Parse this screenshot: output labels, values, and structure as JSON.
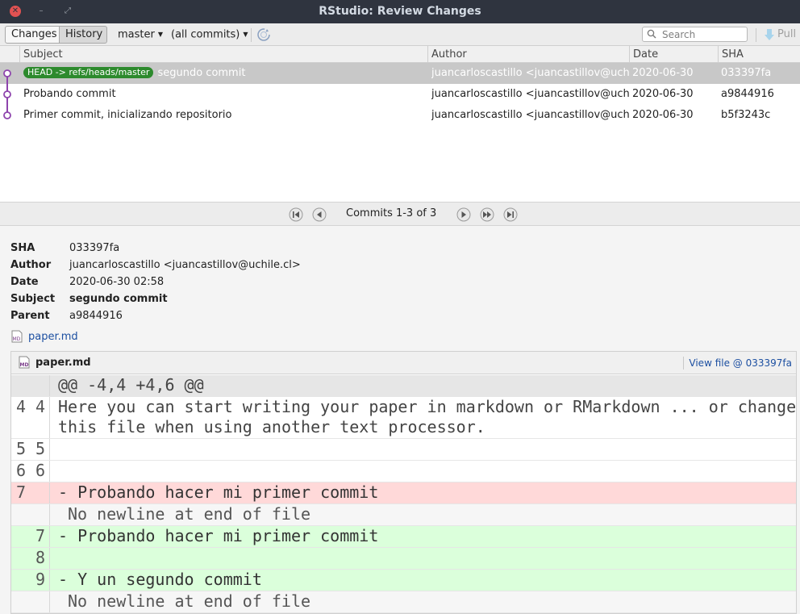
{
  "window": {
    "title": "RStudio: Review Changes"
  },
  "toolbar": {
    "changes_label": "Changes",
    "history_label": "History",
    "branch": "master",
    "filter": "(all commits)",
    "search_placeholder": "Search",
    "pull_label": "Pull"
  },
  "columns": {
    "subject": "Subject",
    "author": "Author",
    "date": "Date",
    "sha": "SHA"
  },
  "commits": [
    {
      "badge": "HEAD -> refs/heads/master",
      "subject": "segundo commit",
      "author": "juancarloscastillo <juancastillov@uchile.cl>",
      "date": "2020-06-30",
      "sha": "033397fa"
    },
    {
      "badge": "",
      "subject": "Probando commit",
      "author": "juancarloscastillo <juancastillov@uchile.cl>",
      "date": "2020-06-30",
      "sha": "a9844916"
    },
    {
      "badge": "",
      "subject": "Primer commit, inicializando repositorio",
      "author": "juancarloscastillo <juancastillov@uchile.cl>",
      "date": "2020-06-30",
      "sha": "b5f3243c"
    }
  ],
  "pager": {
    "label": "Commits 1-3 of 3"
  },
  "detail": {
    "sha_key": "SHA",
    "sha": "033397fa",
    "author_key": "Author",
    "author": "juancarloscastillo <juancastillov@uchile.cl>",
    "date_key": "Date",
    "date": "2020-06-30 02:58",
    "subject_key": "Subject",
    "subject": "segundo commit",
    "parent_key": "Parent",
    "parent": "a9844916",
    "file": "paper.md"
  },
  "diff": {
    "filename": "paper.md",
    "view_link": "View file @ 033397fa",
    "hunk": "@@ -4,4 +4,6 @@",
    "lines": [
      {
        "old": "4",
        "new": "4",
        "text": "Here you can start writing your paper in markdown or RMarkdown ... or change this file when using another text processor."
      },
      {
        "old": "5",
        "new": "5",
        "text": ""
      },
      {
        "old": "6",
        "new": "6",
        "text": ""
      },
      {
        "old": "7",
        "new": "",
        "text": "- Probando hacer mi primer commit"
      },
      {
        "old": "",
        "new": "",
        "text": "No newline at end of file"
      },
      {
        "old": "",
        "new": "7",
        "text": "- Probando hacer mi primer commit"
      },
      {
        "old": "",
        "new": "8",
        "text": ""
      },
      {
        "old": "",
        "new": "9",
        "text": "- Y un segundo commit"
      },
      {
        "old": "",
        "new": "",
        "text": "No newline at end of file"
      }
    ]
  },
  "colors": {
    "titlebar": "#2f343f",
    "badge": "#2d8a2d",
    "graph": "#8e44ad",
    "deleted": "#ffd9d9",
    "added": "#dbffdb",
    "link": "#1c4fa1"
  }
}
